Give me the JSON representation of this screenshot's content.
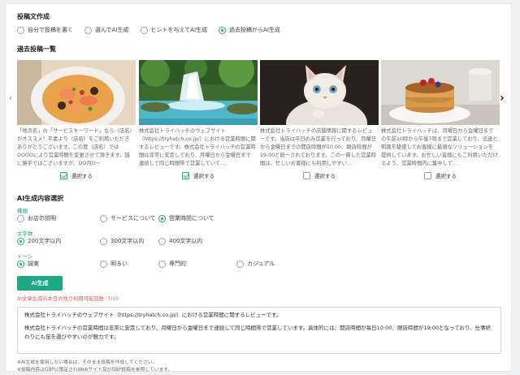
{
  "post_creation": {
    "title": "投稿文作成",
    "options": [
      "自分で投稿を書く",
      "選んでAI生成",
      "ヒントを与えてAI生成",
      "過去投稿からAI生成"
    ],
    "selected_index": 3
  },
  "past_posts": {
    "title": "過去投稿一覧",
    "select_label": "選択する",
    "cards": [
      {
        "image": "seafood-pasta",
        "checked": true,
        "text": "「地点名」の「サービスキーワード」なら（店名）がオススメ！平素より（店名）をご利用いただきありがとうございます。この度（店名）ではOOOOにより営業時間を変更させて頂きます。誠に勝手ではございますが、OO月O〜"
      },
      {
        "image": "waterfall",
        "checked": true,
        "text": "株式会社トライハッチのウェブサイト（https://tryhatch.co.jp/）における営業時間に関するレビューです。株式会社トライハッチの営業時間は非常に安定しており、月曜日から金曜日まで連続して同じ時間帯で営業していて…"
      },
      {
        "image": "kitten",
        "checked": false,
        "text": "株式会社トライハッチの店舗情報に関するレビューです。当店は平日のみ営業を行っており、月曜日から金曜日までの開店時間が10:00、閉店時間が19:00と統一されております。この一貫した営業時間は、忙しいお客様にも利用しやすい…"
      },
      {
        "image": "pancakes",
        "checked": false,
        "text": "株式会社トライハッチは、月曜日から金曜日までの午前10時から午後7時まで営業しており、迅速と知識を駆使してお客様に最適なソリューションを提供しています。お忙しい皆様にもご利用いただけるよう、営業時間内に集中して…"
      }
    ]
  },
  "ai_content": {
    "title": "AI生成内容選択",
    "category": {
      "label": "種類",
      "options": [
        "お店の説明",
        "サービスについて",
        "営業時間について"
      ],
      "selected_index": 2
    },
    "length": {
      "label": "文字数",
      "options": [
        "200文字以内",
        "300文字以内",
        "400文字以内"
      ],
      "selected_index": 0
    },
    "tone": {
      "label": "トーン",
      "options": [
        "誠実",
        "明るい",
        "専門的",
        "カジュアル"
      ],
      "selected_index": 0
    }
  },
  "generate_button": "AI生成",
  "remaining_note": "AI文章生成の本日の残り利用可能回数: 7/10",
  "output_text": [
    "株式会社トライハッチのウェブサイト（https://tryhatch.co.jp/）における営業時間に関するレビューです。",
    "株式会社トライハッチの営業時間は非常に安定しており、月曜日から金曜日まで連続して同じ時間帯で営業しています。具体的には、開店時間が毎日10:00、閉店時間が19:00となっており、仕事終わりにも足を運びやすいのが魅力です。"
  ],
  "footnotes": [
    "※AI生成を使用しない場合は、そのまま投稿を作成してください。",
    "※投稿内容はGBPに限定されWebサイト及びGBP投稿を参照しています。"
  ],
  "colors": {
    "accent": "#1ea884",
    "warning": "#e05a5a"
  }
}
